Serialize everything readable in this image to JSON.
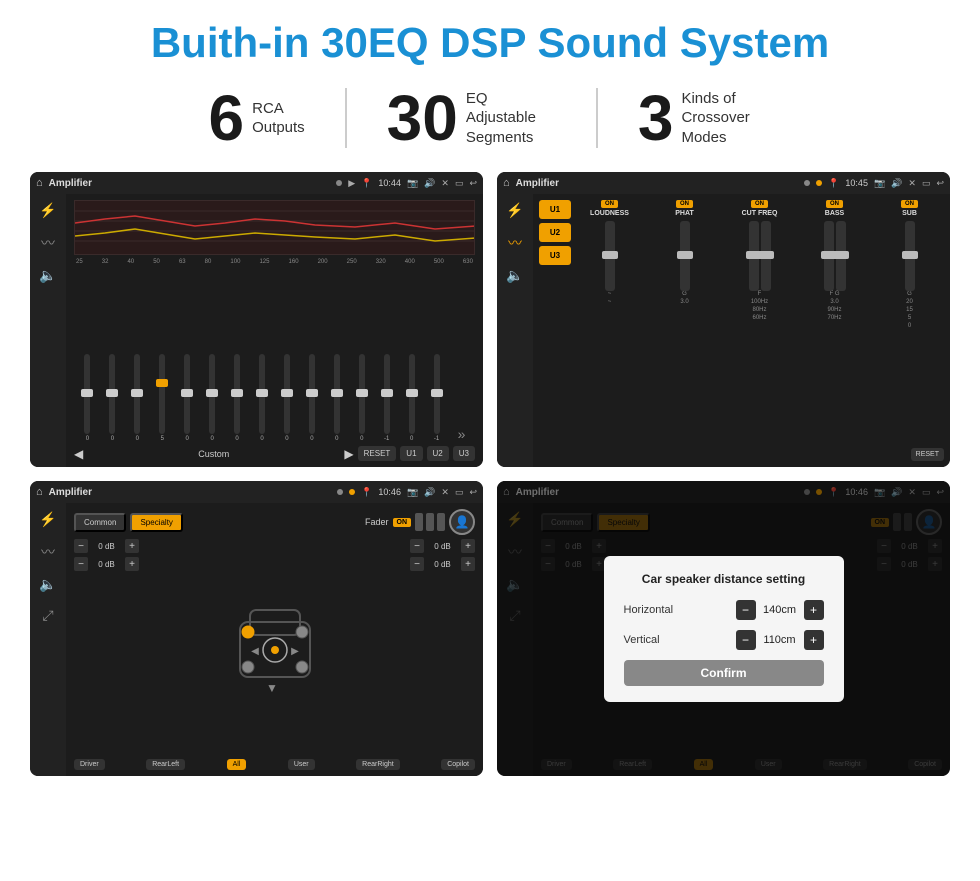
{
  "title": "Buith-in 30EQ DSP Sound System",
  "stats": [
    {
      "number": "6",
      "label": "RCA\nOutputs"
    },
    {
      "number": "30",
      "label": "EQ Adjustable\nSegments"
    },
    {
      "number": "3",
      "label": "Kinds of\nCrossover Modes"
    }
  ],
  "screens": {
    "eq": {
      "topbar": {
        "title": "Amplifier",
        "time": "10:44"
      },
      "freq_labels": [
        "25",
        "32",
        "40",
        "50",
        "63",
        "80",
        "100",
        "125",
        "160",
        "200",
        "250",
        "320",
        "400",
        "500",
        "630"
      ],
      "slider_values": [
        "0",
        "0",
        "0",
        "5",
        "0",
        "0",
        "0",
        "0",
        "0",
        "0",
        "0",
        "0",
        "-1",
        "0",
        "-1"
      ],
      "buttons": [
        "Custom",
        "RESET",
        "U1",
        "U2",
        "U3"
      ]
    },
    "mixer": {
      "topbar": {
        "title": "Amplifier",
        "time": "10:45"
      },
      "u_buttons": [
        "U1",
        "U2",
        "U3"
      ],
      "channels": [
        {
          "name": "LOUDNESS",
          "on": true
        },
        {
          "name": "PHAT",
          "on": true
        },
        {
          "name": "CUT FREQ",
          "on": true
        },
        {
          "name": "BASS",
          "on": true
        },
        {
          "name": "SUB",
          "on": true
        }
      ],
      "reset_label": "RESET"
    },
    "fader": {
      "topbar": {
        "title": "Amplifier",
        "time": "10:46"
      },
      "tabs": [
        "Common",
        "Specialty"
      ],
      "fader_label": "Fader",
      "on_label": "ON",
      "db_values": [
        "0 dB",
        "0 dB",
        "0 dB",
        "0 dB"
      ],
      "buttons": [
        "Driver",
        "RearLeft",
        "All",
        "User",
        "RearRight",
        "Copilot"
      ]
    },
    "distance": {
      "topbar": {
        "title": "Amplifier",
        "time": "10:46"
      },
      "tabs": [
        "Common",
        "Specialty"
      ],
      "on_label": "ON",
      "dialog": {
        "title": "Car speaker distance setting",
        "horizontal_label": "Horizontal",
        "horizontal_value": "140cm",
        "vertical_label": "Vertical",
        "vertical_value": "110cm",
        "confirm_label": "Confirm"
      },
      "db_values": [
        "0 dB",
        "0 dB"
      ],
      "buttons": [
        "Driver",
        "RearLeft",
        "All",
        "User",
        "RearRight",
        "Copilot"
      ]
    }
  },
  "icons": {
    "home": "⌂",
    "pin": "📍",
    "volume": "🔊",
    "back": "↩",
    "camera": "📷",
    "eq_icon": "⚡",
    "wave_icon": "〰",
    "speaker_icon": "🔈",
    "menu_icon": "☰",
    "person_icon": "👤",
    "expand_icon": "»"
  }
}
